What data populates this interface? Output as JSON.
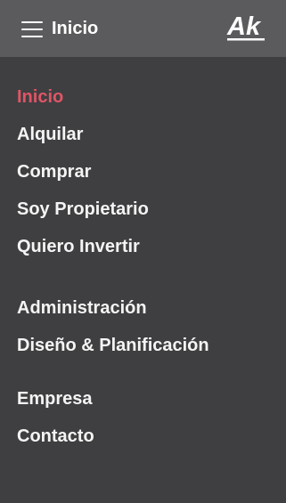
{
  "header": {
    "title": "Inicio",
    "menu_icon": "hamburger-menu-icon",
    "logo_text": "Ak"
  },
  "menu": {
    "items": [
      {
        "label": "Inicio",
        "active": true
      },
      {
        "label": "Alquilar",
        "active": false
      },
      {
        "label": "Comprar",
        "active": false
      },
      {
        "label": "Soy Propietario",
        "active": false
      },
      {
        "label": "Quiero Invertir",
        "active": false
      },
      {
        "label": "Administración",
        "active": false
      },
      {
        "label": "Diseño & Planificación",
        "active": false
      },
      {
        "label": "Empresa",
        "active": false
      },
      {
        "label": "Contacto",
        "active": false
      }
    ]
  },
  "colors": {
    "header_bg": "#5b5b5d",
    "menu_bg": "#3f3f41",
    "text": "#f4f4f4",
    "active": "#e05566"
  }
}
